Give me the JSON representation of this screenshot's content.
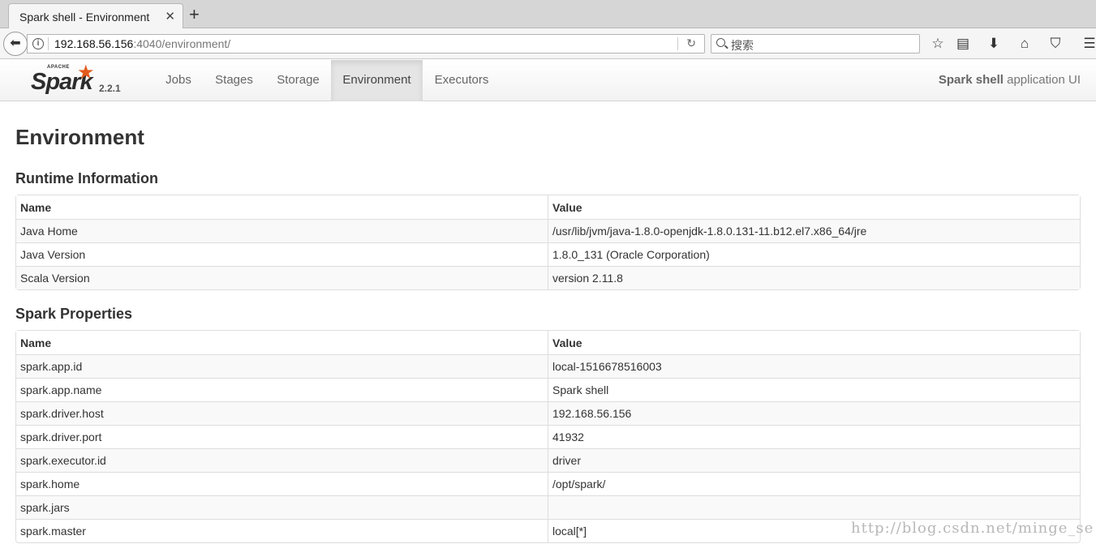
{
  "browser": {
    "tab_title": "Spark shell - Environment",
    "tab_close": "✕",
    "new_tab": "+",
    "url_host": "192.168.56.156",
    "url_path": ":4040/environment/",
    "search_placeholder": "搜索"
  },
  "spark": {
    "logo_apache": "APACHE",
    "logo_word": "Spark",
    "version": "2.2.1",
    "tabs": [
      {
        "label": "Jobs"
      },
      {
        "label": "Stages"
      },
      {
        "label": "Storage"
      },
      {
        "label": "Environment",
        "active": true
      },
      {
        "label": "Executors"
      }
    ],
    "app_name": "Spark shell",
    "app_suffix": " application UI"
  },
  "page": {
    "title": "Environment",
    "runtime": {
      "title": "Runtime Information",
      "headers": [
        "Name",
        "Value"
      ],
      "rows": [
        [
          "Java Home",
          "/usr/lib/jvm/java-1.8.0-openjdk-1.8.0.131-11.b12.el7.x86_64/jre"
        ],
        [
          "Java Version",
          "1.8.0_131 (Oracle Corporation)"
        ],
        [
          "Scala Version",
          "version 2.11.8"
        ]
      ]
    },
    "spark_properties": {
      "title": "Spark Properties",
      "headers": [
        "Name",
        "Value"
      ],
      "rows": [
        [
          "spark.app.id",
          "local-1516678516003"
        ],
        [
          "spark.app.name",
          "Spark shell"
        ],
        [
          "spark.driver.host",
          "192.168.56.156"
        ],
        [
          "spark.driver.port",
          "41932"
        ],
        [
          "spark.executor.id",
          "driver"
        ],
        [
          "spark.home",
          "/opt/spark/"
        ],
        [
          "spark.jars",
          ""
        ],
        [
          "spark.master",
          "local[*]"
        ]
      ]
    }
  },
  "watermark": "http://blog.csdn.net/minge_se",
  "colors": {
    "spark_orange": "#e25a1c",
    "active_tab_bg": "#e5e5e5",
    "row_stripe": "#f9f9f9"
  }
}
